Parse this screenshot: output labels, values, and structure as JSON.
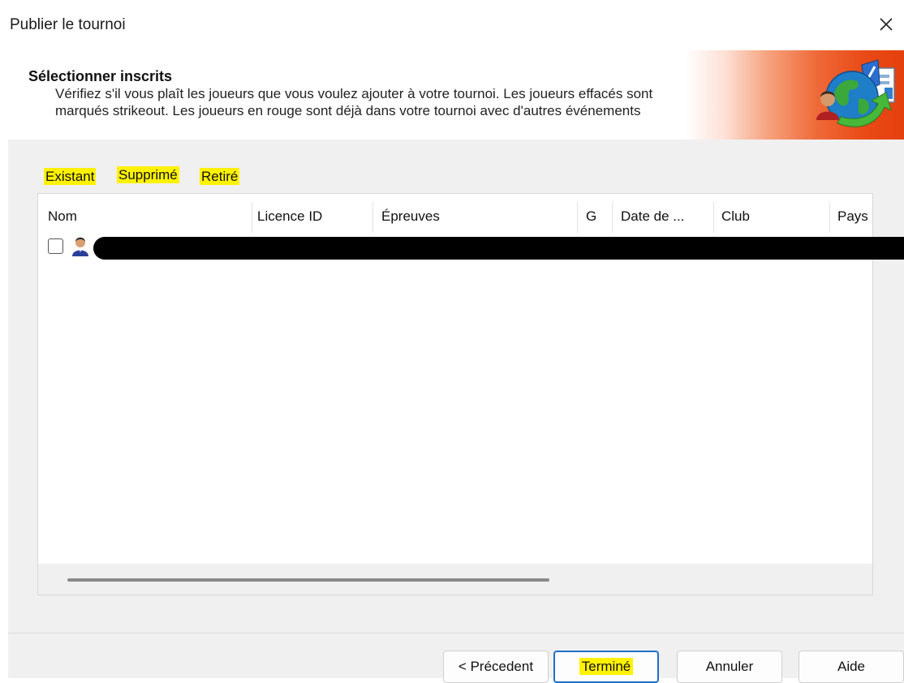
{
  "window": {
    "title": "Publier le tournoi",
    "close_icon": "close-icon"
  },
  "header": {
    "title": "Sélectionner inscrits",
    "description": "Vérifiez s'il vous plaît les joueurs que vous voulez ajouter à votre tournoi. Les joueurs effacés sont marqués strikeout. Les joueurs en rouge sont déjà dans votre tournoi avec d'autres événements",
    "icon": "globe-publish-icon",
    "gradient_colors": [
      "#ffffff",
      "#e4400e"
    ]
  },
  "tabs": [
    {
      "label": "Existant",
      "highlighted": true
    },
    {
      "label": "Supprimé",
      "highlighted": true,
      "selected": true
    },
    {
      "label": "Retiré",
      "highlighted": true
    }
  ],
  "table": {
    "columns": [
      "Nom",
      "Licence ID",
      "Épreuves",
      "G",
      "Date de ...",
      "Club",
      "Pays"
    ],
    "rows": [
      {
        "checked": false,
        "icon": "player-icon",
        "redacted": true
      }
    ]
  },
  "buttons": {
    "previous": "< Précedent",
    "finish": "Terminé",
    "cancel": "Annuler",
    "help": "Aide"
  },
  "colors": {
    "highlight": "#fff200",
    "primary_border": "#1e6fc8",
    "panel_bg": "#f0f0f0"
  }
}
